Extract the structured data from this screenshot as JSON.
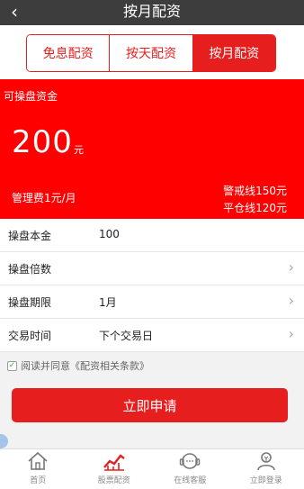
{
  "nav": {
    "back_icon": "back-chevron-icon",
    "title": "按月配资"
  },
  "tabs": [
    {
      "label": "免息配资",
      "active": false
    },
    {
      "label": "按天配资",
      "active": false
    },
    {
      "label": "按月配资",
      "active": true
    }
  ],
  "hero": {
    "label": "可操盘资金",
    "amount": "200",
    "unit": "元",
    "fee": "管理费1元/月",
    "warning_line": "警戒线150元",
    "closeout_line": "平仓线120元"
  },
  "form": {
    "rows": [
      {
        "label": "操盘本金",
        "value": "100",
        "arrow": false
      },
      {
        "label": "操盘倍数",
        "value": "",
        "arrow": true
      },
      {
        "label": "操盘期限",
        "value": "1月",
        "arrow": true
      },
      {
        "label": "交易时间",
        "value": "下个交易日",
        "arrow": true
      }
    ],
    "arrow_glyph": "›"
  },
  "agreement": {
    "checked": true,
    "prefix": "阅读并同意",
    "link": "《配资相关条款》"
  },
  "apply_button": {
    "label": "立即申请"
  },
  "tabbar": [
    {
      "label": "首页",
      "icon": "home-icon"
    },
    {
      "label": "股票配资",
      "icon": "stock-chart-icon",
      "active": true
    },
    {
      "label": "在线客服",
      "icon": "customer-service-icon"
    },
    {
      "label": "立即登录",
      "icon": "user-login-icon"
    }
  ],
  "colors": {
    "brand_red": "#e61e1e",
    "hero_red": "#ff0000",
    "navbar": "#3d3d3d"
  }
}
